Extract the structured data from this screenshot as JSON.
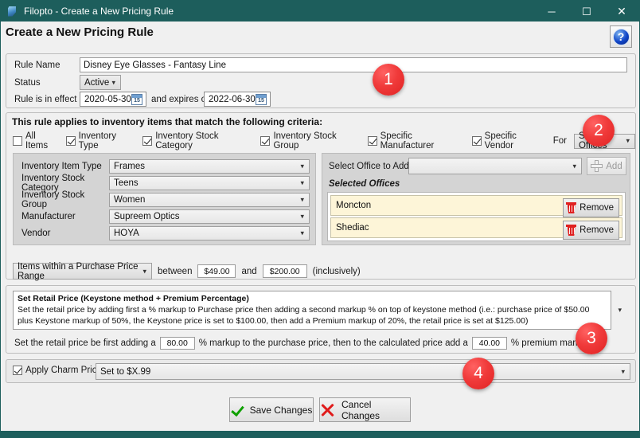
{
  "window": {
    "title": "Filopto - Create a New Pricing Rule",
    "minimize": "─",
    "maximize": "☐",
    "close": "✕",
    "app_icon": "filopto-logo-icon"
  },
  "header": {
    "page_title": "Create a New Pricing Rule",
    "help_label": "?"
  },
  "section1": {
    "rule_name_label": "Rule Name",
    "rule_name_value": "Disney Eye Glasses - Fantasy Line",
    "status_label": "Status",
    "status_value": "Active",
    "effect_label": "Rule is in effect on",
    "effect_date": "2020-05-30",
    "expires_label": "and expires on",
    "expires_date": "2022-06-30",
    "calendar_day": "15"
  },
  "section2": {
    "title": "This rule applies to inventory items that match the following criteria:",
    "checkboxes": [
      {
        "label": "All Items",
        "checked": false
      },
      {
        "label": "Inventory Type",
        "checked": true
      },
      {
        "label": "Inventory Stock Category",
        "checked": true
      },
      {
        "label": "Inventory Stock Group",
        "checked": true
      },
      {
        "label": "Specific Manufacturer",
        "checked": true
      },
      {
        "label": "Specific Vendor",
        "checked": true
      }
    ],
    "for_label": "For",
    "for_value": "Select Offices",
    "fields": [
      {
        "label": "Inventory Item Type",
        "value": "Frames"
      },
      {
        "label": "Inventory Stock Category",
        "value": "Teens"
      },
      {
        "label": "Inventory Stock Group",
        "value": "Women"
      },
      {
        "label": "Manufacturer",
        "value": "Supreem Optics"
      },
      {
        "label": "Vendor",
        "value": "HOYA"
      }
    ],
    "select_office_label": "Select Office to Add:",
    "select_office_value": "",
    "add_label": "Add",
    "selected_offices_label": "Selected Offices",
    "offices": [
      {
        "name": "Moncton",
        "remove_label": "Remove"
      },
      {
        "name": "Shediac",
        "remove_label": "Remove"
      }
    ],
    "price_range_value": "Items within a Purchase Price Range",
    "between_label": "between",
    "min_price": "$49.00",
    "and_label": "and",
    "max_price": "$200.00",
    "inclusive_label": "(inclusively)"
  },
  "section3": {
    "method_title": "Set Retail Price (Keystone method + Premium Percentage)",
    "method_desc": "Set the retail price by adding first a % markup to Purchase price then adding a second markup % on top of keystone method (i.e.: purchase price of $50.00 plus Keystone markup of 50%, the Keystone price is set to $100.00, then add a Premium markup of 20%, the retail price is set at $125.00)",
    "markup_text_1": "Set the retail price be first adding a",
    "markup_value_1": "80.00",
    "markup_text_2": "% markup to the purchase price, then to the calculated price add a",
    "markup_value_2": "40.00",
    "markup_text_3": "% premium markup"
  },
  "section4": {
    "charm_label": "Apply Charm Pricing",
    "charm_checked": true,
    "charm_value": "Set to $X.99"
  },
  "footer": {
    "save_label": "Save Changes",
    "cancel_label": "Cancel Changes"
  },
  "badges": [
    {
      "number": "1"
    },
    {
      "number": "2"
    },
    {
      "number": "3"
    },
    {
      "number": "4"
    }
  ],
  "colors": {
    "titlebar": "#1d5e5c",
    "badge": "#e02323",
    "office_row": "#fdf5d8",
    "accent_blue": "#1045c8"
  }
}
